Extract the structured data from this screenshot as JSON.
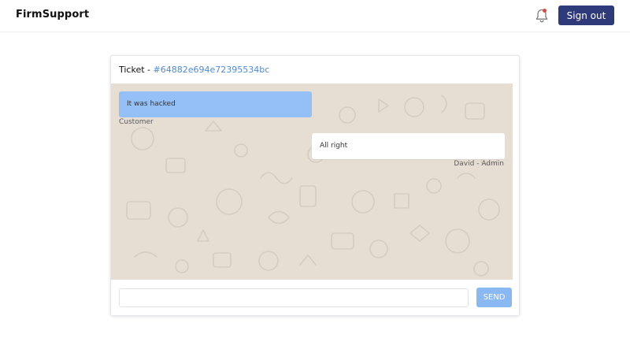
{
  "header": {
    "brand": "FirmSupport",
    "signout_label": "Sign out",
    "notification_icon": "bell-icon",
    "has_unread_notifications": true
  },
  "ticket": {
    "label": "Ticket - ",
    "id": "#64882e694e72395534bc"
  },
  "messages": [
    {
      "text": "It was hacked",
      "sender": "Customer",
      "side": "left"
    },
    {
      "text": "All right",
      "sender": "David - Admin",
      "side": "right"
    }
  ],
  "composer": {
    "value": "",
    "placeholder": "",
    "send_label": "SEND"
  },
  "colors": {
    "signout_bg": "#2e3a7a",
    "notification_dot": "#e0463a",
    "customer_bubble": "#95bff7",
    "admin_bubble": "#ffffff",
    "chat_background": "#e6ded3",
    "ticket_link": "#4f8ad6",
    "send_bg": "#8ab8f2"
  }
}
